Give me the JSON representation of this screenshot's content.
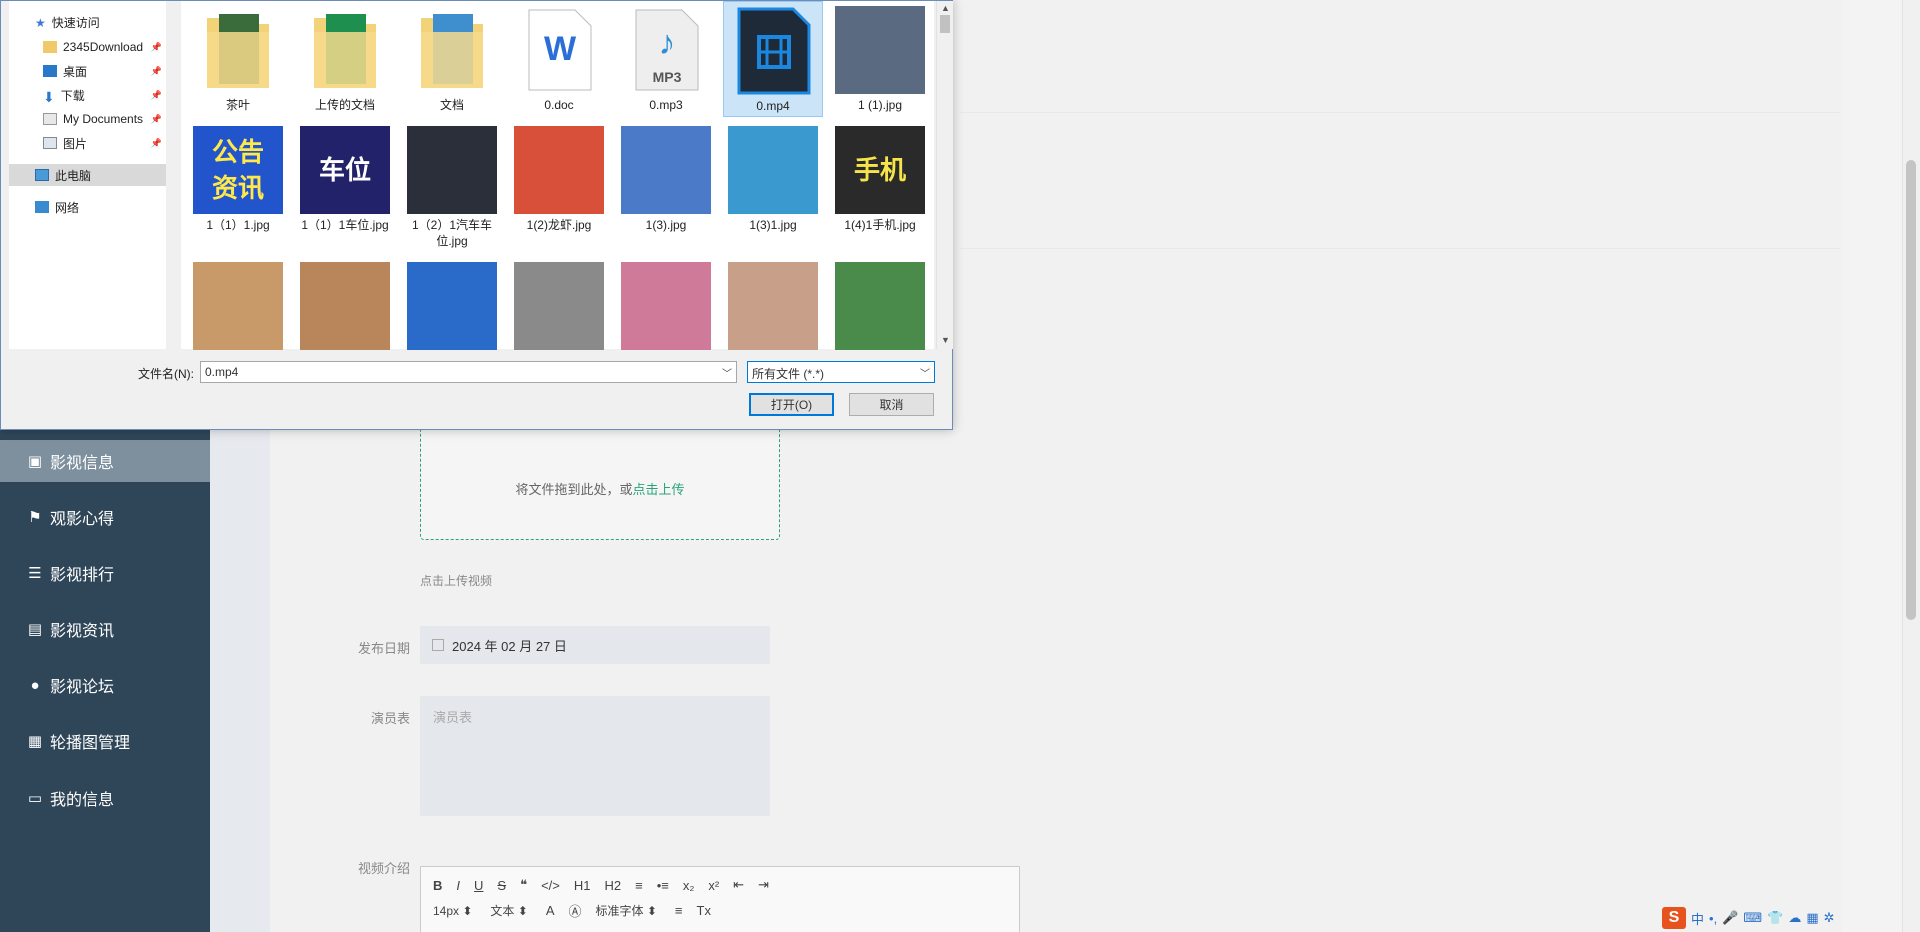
{
  "sidebar": {
    "items": [
      {
        "label": "影视信息",
        "icon": "monitor-icon",
        "active": true
      },
      {
        "label": "观影心得",
        "icon": "flag-icon",
        "active": false
      },
      {
        "label": "影视排行",
        "icon": "ranking-icon",
        "active": false
      },
      {
        "label": "影视资讯",
        "icon": "clipboard-icon",
        "active": false
      },
      {
        "label": "影视论坛",
        "icon": "user-icon",
        "active": false
      },
      {
        "label": "轮播图管理",
        "icon": "grid-icon",
        "active": false
      },
      {
        "label": "我的信息",
        "icon": "card-icon",
        "active": false
      }
    ]
  },
  "form": {
    "upload_text": "将文件拖到此处，或",
    "upload_link": "点击上传",
    "upload_hint": "点击上传视频",
    "date_label": "发布日期",
    "date_value": "2024 年 02 月 27 日",
    "actors_label": "演员表",
    "actors_placeholder": "演员表",
    "intro_label": "视频介绍",
    "editor": {
      "font_size": "14px",
      "text_type": "文本",
      "font_family": "标准字体",
      "buttons": [
        "B",
        "I",
        "U",
        "S",
        "❝",
        "</>",
        "H1",
        "H2",
        "≡",
        "•≡",
        "x₂",
        "x²",
        "⇤",
        "⇥"
      ]
    }
  },
  "dialog": {
    "nav": [
      {
        "label": "快速访问",
        "icon": "star-icon",
        "pinned": false,
        "selected": false
      },
      {
        "label": "2345Download",
        "icon": "folder-icon",
        "pinned": true,
        "selected": false
      },
      {
        "label": "桌面",
        "icon": "desktop-icon",
        "pinned": true,
        "selected": false
      },
      {
        "label": "下载",
        "icon": "download-icon",
        "pinned": true,
        "selected": false
      },
      {
        "label": "My Documents",
        "icon": "documents-icon",
        "pinned": true,
        "selected": false
      },
      {
        "label": "图片",
        "icon": "pictures-icon",
        "pinned": true,
        "selected": false
      },
      {
        "label": "此电脑",
        "icon": "computer-icon",
        "pinned": false,
        "selected": true
      },
      {
        "label": "网络",
        "icon": "network-icon",
        "pinned": false,
        "selected": false
      }
    ],
    "files": [
      {
        "name": "茶叶",
        "kind": "folder",
        "color": "#3a6b3a"
      },
      {
        "name": "上传的文档",
        "kind": "folder-doc",
        "color": "#1f8f4f"
      },
      {
        "name": "文档",
        "kind": "folder",
        "color": "#3f8fcf"
      },
      {
        "name": "0.doc",
        "kind": "word",
        "color": "#2b6fd6"
      },
      {
        "name": "0.mp3",
        "kind": "mp3",
        "color": "#2b8fd6"
      },
      {
        "name": "0.mp4",
        "kind": "video",
        "color": "#1a88e0",
        "selected": true
      },
      {
        "name": "1 (1).jpg",
        "kind": "photo",
        "color": "#5a6a80"
      },
      {
        "name": "1（1）1.jpg",
        "kind": "poster",
        "color": "#2255cc",
        "caption": "公告\n资讯"
      },
      {
        "name": "1（1）1车位.jpg",
        "kind": "poster",
        "color": "#22226a",
        "caption": "车位"
      },
      {
        "name": "1（2）1汽车车位.jpg",
        "kind": "photo",
        "color": "#2a2f3a"
      },
      {
        "name": "1(2)龙虾.jpg",
        "kind": "photo",
        "color": "#d8503a"
      },
      {
        "name": "1(3).jpg",
        "kind": "photo",
        "color": "#4a7ac8"
      },
      {
        "name": "1(3)1.jpg",
        "kind": "photo",
        "color": "#3a9ad0"
      },
      {
        "name": "1(4)1手机.jpg",
        "kind": "poster",
        "color": "#2a2a2a",
        "caption": "手机"
      },
      {
        "name": "",
        "kind": "photo",
        "color": "#c89a6a"
      },
      {
        "name": "",
        "kind": "photo",
        "color": "#b8865a"
      },
      {
        "name": "",
        "kind": "photo",
        "color": "#2a6ac8"
      },
      {
        "name": "",
        "kind": "photo",
        "color": "#8a8a8a"
      },
      {
        "name": "",
        "kind": "photo",
        "color": "#d07a9a"
      },
      {
        "name": "",
        "kind": "photo",
        "color": "#c8a08a"
      },
      {
        "name": "",
        "kind": "photo",
        "color": "#4a8a4a"
      }
    ],
    "filename_label": "文件名(N):",
    "filename_value": "0.mp4",
    "filetype_value": "所有文件 (*.*)",
    "open_label": "打开(O)",
    "cancel_label": "取消"
  },
  "tray": {
    "items": [
      "S",
      "中",
      "•,",
      "🎤",
      "⌨",
      "👕",
      "☁",
      "▦",
      "✲"
    ]
  }
}
